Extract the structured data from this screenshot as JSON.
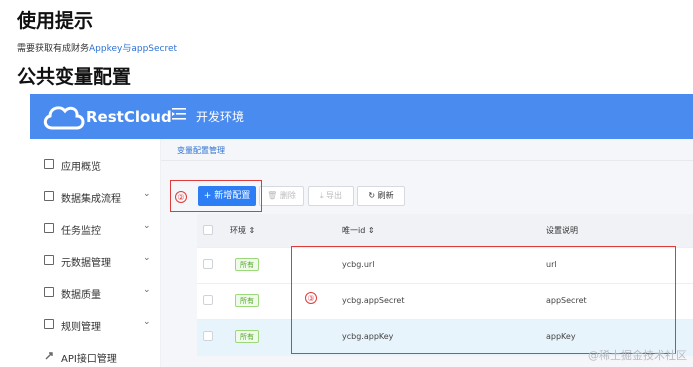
{
  "doc": {
    "heading1": "使用提示",
    "tip_prefix": "需要获取有成财务",
    "tip_link": "Appkey与appSecret",
    "heading2": "公共变量配置"
  },
  "app": {
    "brand": "RestCloud",
    "env": "开发环境",
    "breadcrumb": "变量配置管理"
  },
  "sidebar": {
    "items": [
      {
        "label": "应用概览",
        "icon": "dashboard-icon",
        "chevron": false
      },
      {
        "label": "数据集成流程",
        "icon": "grid-icon",
        "chevron": true
      },
      {
        "label": "任务监控",
        "icon": "monitor-icon",
        "chevron": true
      },
      {
        "label": "元数据管理",
        "icon": "metadata-icon",
        "chevron": true
      },
      {
        "label": "数据质量",
        "icon": "quality-icon",
        "chevron": true
      },
      {
        "label": "规则管理",
        "icon": "rule-icon",
        "chevron": true
      },
      {
        "label": "API接口管理",
        "icon": "link-icon",
        "chevron": false
      }
    ]
  },
  "toolbar": {
    "new_label": "+ 新增配置",
    "delete_label": "删除",
    "export_label": "导出",
    "refresh_label": "刷新"
  },
  "table": {
    "headers": [
      "环境",
      "唯一id",
      "设置说明"
    ],
    "rows": [
      {
        "env": "所有",
        "id": "ycbg.url",
        "desc": "url"
      },
      {
        "env": "所有",
        "id": "ycbg.appSecret",
        "desc": "appSecret"
      },
      {
        "env": "所有",
        "id": "ycbg.appKey",
        "desc": "appKey"
      }
    ]
  },
  "annotations": {
    "marker2": "②",
    "marker3": "③",
    "color": "#e03b3b"
  },
  "watermark": "@稀土掘金技术社区",
  "colors": {
    "topbar": "#4a8bf0",
    "primary": "#2d7ef5",
    "tag_green": "#52a629"
  }
}
